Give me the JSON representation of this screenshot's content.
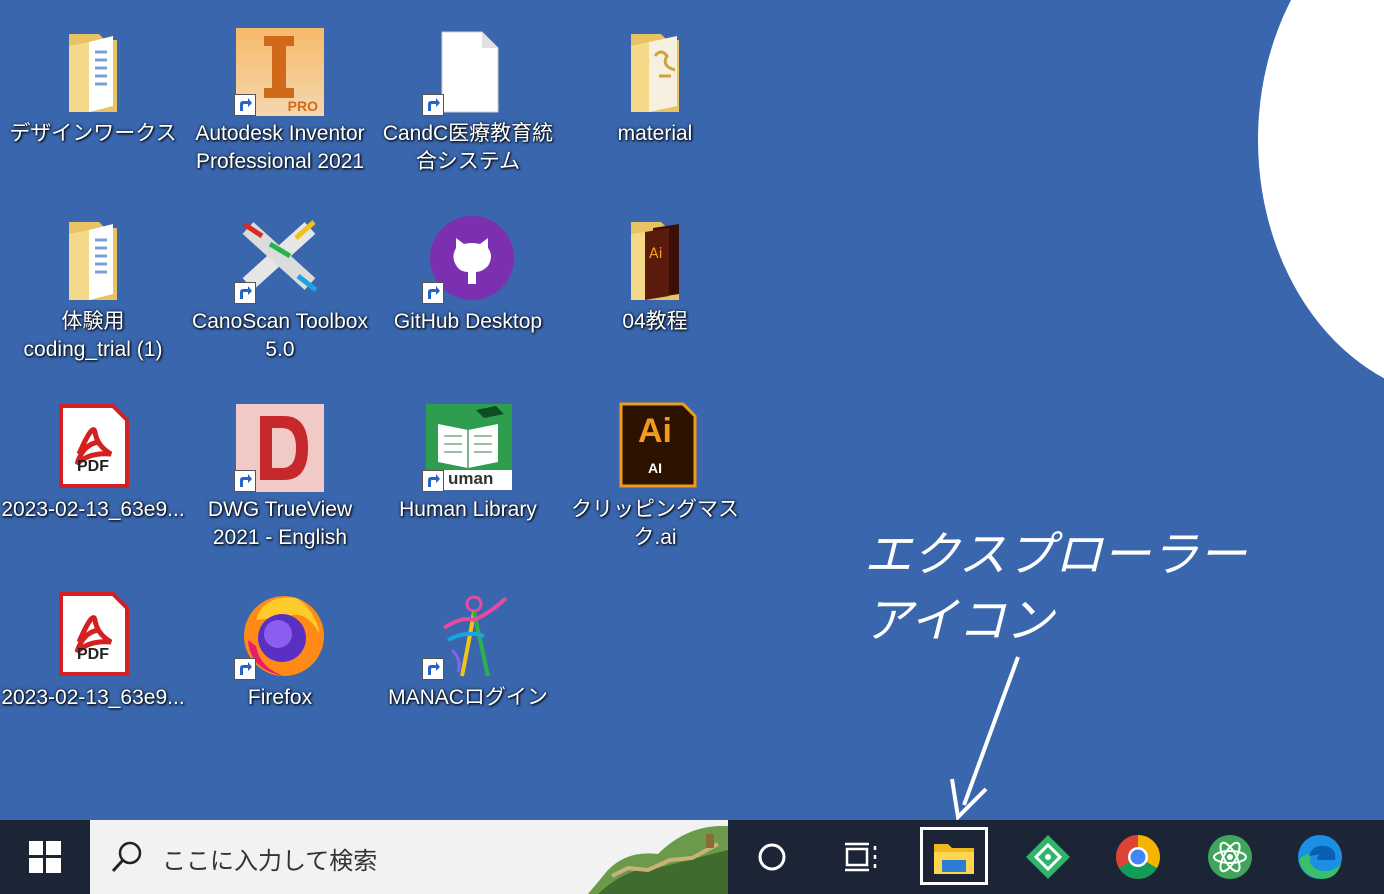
{
  "desktop": {
    "icons": [
      {
        "label": "デザインワークス",
        "icon": "folder-icon"
      },
      {
        "label": "Autodesk Inventor\nProfessional 2021",
        "icon": "autodesk-inventor-icon"
      },
      {
        "label": "CandC医療教育統\n合システム",
        "icon": "blank-file-icon"
      },
      {
        "label": "material",
        "icon": "folder-icon"
      },
      {
        "label": "体験用\ncoding_trial (1)",
        "icon": "folder-icon"
      },
      {
        "label": "CanoScan Toolbox\n5.0",
        "icon": "canoscan-icon"
      },
      {
        "label": "GitHub Desktop",
        "icon": "github-desktop-icon"
      },
      {
        "label": "04教程",
        "icon": "folder-icon"
      },
      {
        "label": "2023-02-13_63e9...",
        "icon": "pdf-icon"
      },
      {
        "label": "DWG TrueView\n2021 - English",
        "icon": "dwg-trueview-icon"
      },
      {
        "label": "Human Library",
        "icon": "human-library-icon"
      },
      {
        "label": "クリッピングマスク.ai",
        "icon": "illustrator-file-icon"
      },
      {
        "label": "2023-02-13_63e9...",
        "icon": "pdf-icon"
      },
      {
        "label": "Firefox",
        "icon": "firefox-icon"
      },
      {
        "label": "MANACログイン",
        "icon": "manac-icon"
      }
    ],
    "badges": {
      "inventor": "PRO",
      "pdf": "PDF",
      "ai_big": "Ai",
      "ai_small": "AI",
      "human": "uman"
    }
  },
  "annotation": {
    "text": "エクスプローラー\nアイコン"
  },
  "taskbar": {
    "search_placeholder": "ここに入力して検索",
    "items": [
      "windows-start-icon",
      "search-icon",
      "cortana-icon",
      "task-view-icon",
      "file-explorer-icon",
      "app-green-diamond-icon",
      "chrome-icon",
      "atom-icon",
      "edge-icon"
    ]
  },
  "colors": {
    "desktop_bg": "#3966ad",
    "taskbar_bg": "#1b2536",
    "search_bg": "#f2f2f2"
  }
}
